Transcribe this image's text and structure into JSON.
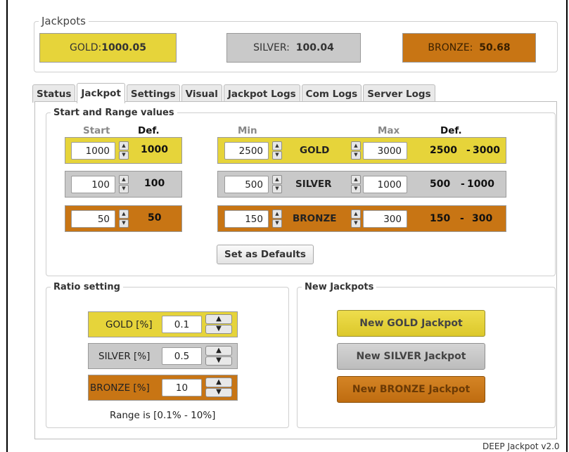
{
  "jackpots": {
    "legend": "Jackpots",
    "gold": {
      "label": "GOLD:",
      "value": "1000.05"
    },
    "silver": {
      "label": "SILVER:",
      "value": "100.04"
    },
    "bronze": {
      "label": "BRONZE:",
      "value": "50.68"
    }
  },
  "tabs": [
    "Status",
    "Jackpot",
    "Settings",
    "Visual",
    "Jackpot Logs",
    "Com Logs",
    "Server Logs"
  ],
  "active_tab": "Jackpot",
  "start_range": {
    "legend": "Start and Range values",
    "headers": {
      "start": "Start",
      "def": "Def.",
      "min": "Min",
      "max": "Max",
      "def2": "Def."
    },
    "rows": [
      {
        "start": "1000",
        "def": "1000",
        "min": "2500",
        "name": "GOLD",
        "max": "3000",
        "range_min": "2500",
        "dash": "-",
        "range_max": "3000"
      },
      {
        "start": "100",
        "def": "100",
        "min": "500",
        "name": "SILVER",
        "max": "1000",
        "range_min": "500",
        "dash": "-",
        "range_max": "1000"
      },
      {
        "start": "50",
        "def": "50",
        "min": "150",
        "name": "BRONZE",
        "max": "300",
        "range_min": "150",
        "dash": "-",
        "range_max": "300"
      }
    ],
    "set_defaults_label": "Set as Defaults"
  },
  "ratio": {
    "legend": "Ratio setting",
    "rows": [
      {
        "label": "GOLD [%]",
        "value": "0.1"
      },
      {
        "label": "SILVER [%]",
        "value": "0.5"
      },
      {
        "label": "BRONZE [%]",
        "value": "10"
      }
    ],
    "range_note": "Range is [0.1% - 10%]"
  },
  "new_jackpots": {
    "legend": "New Jackpots",
    "gold_label": "New GOLD Jackpot",
    "silver_label": "New SILVER Jackpot",
    "bronze_label": "New BRONZE Jackpot"
  },
  "footer": {
    "version": "DEEP Jackpot v2.0"
  },
  "colors": {
    "gold": "#e6d43a",
    "silver": "#c9c9c9",
    "bronze": "#c87514"
  }
}
